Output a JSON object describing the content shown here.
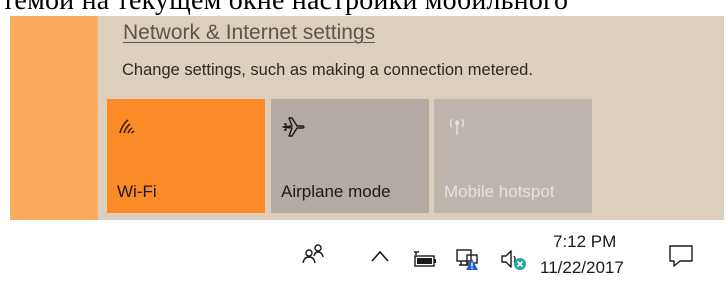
{
  "background_text": "темой на текущем окне настройки мобильного",
  "flyout": {
    "settings_link": "Network & Internet settings",
    "settings_description": "Change settings, such as making a connection metered.",
    "accent_color": "#fbab60",
    "tiles": [
      {
        "label": "Wi-Fi",
        "icon": "wifi-icon",
        "state": "on",
        "color": "#fc8a26"
      },
      {
        "label": "Airplane mode",
        "icon": "airplane-icon",
        "state": "off",
        "color": "#b3aaa3"
      },
      {
        "label": "Mobile hotspot",
        "icon": "hotspot-icon",
        "state": "disabled",
        "color": "#bdb5ae"
      }
    ]
  },
  "taskbar": {
    "icons": [
      "people-icon",
      "chevron-up-icon",
      "battery-icon",
      "network-warning-icon",
      "volume-muted-icon",
      "notifications-icon"
    ],
    "clock": {
      "time": "7:12 PM",
      "date": "11/22/2017"
    }
  }
}
